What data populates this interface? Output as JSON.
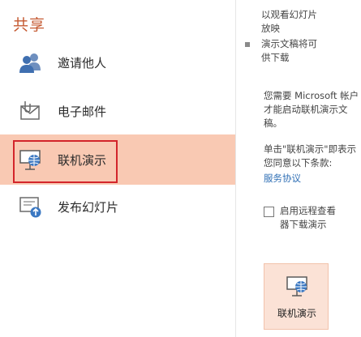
{
  "title": "共享",
  "nav": {
    "items": [
      {
        "label": "邀请他人",
        "icon": "people-icon"
      },
      {
        "label": "电子邮件",
        "icon": "email-icon"
      },
      {
        "label": "联机演示",
        "icon": "online-presentation-icon"
      },
      {
        "label": "发布幻灯片",
        "icon": "publish-slides-icon"
      }
    ],
    "active_index": 2
  },
  "detail": {
    "bullet_1": "以观看幻灯片放映",
    "bullet_2": "演示文稿将可供下载",
    "requirement": "您需要 Microsoft 帐户才能启动联机演示文稿。",
    "agreement": "单击\"联机演示\"即表示您同意以下条款:",
    "service_link": "服务协议",
    "checkbox_label": "启用远程查看器下载演示",
    "checkbox_checked": false
  },
  "action_button": {
    "label": "联机演示",
    "icon": "online-presentation-icon"
  },
  "colors": {
    "accent": "#c55a32",
    "active_bg": "#f9c9b3",
    "highlight_border": "#d3252b",
    "link": "#2f6fb5"
  }
}
